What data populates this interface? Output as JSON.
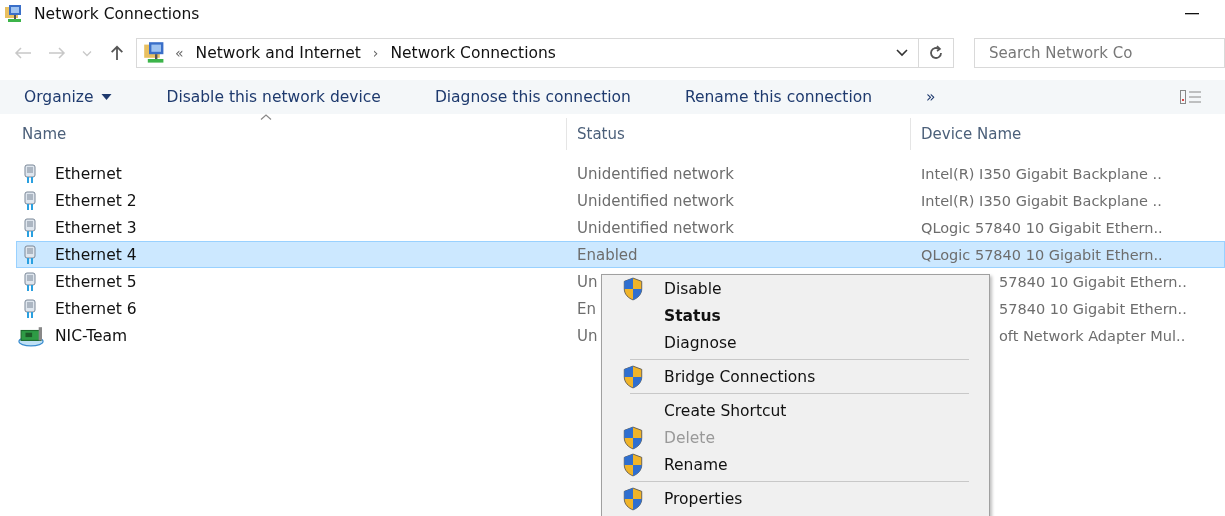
{
  "window": {
    "title": "Network Connections"
  },
  "address": {
    "prefix": "«",
    "separator": "›",
    "crumbs": [
      "Network and Internet",
      "Network Connections"
    ]
  },
  "search": {
    "placeholder": "Search Network Co"
  },
  "toolbar": {
    "items": [
      {
        "label": "Organize",
        "kind": "menu"
      },
      {
        "label": "Disable this network device",
        "kind": "command"
      },
      {
        "label": "Diagnose this connection",
        "kind": "command"
      },
      {
        "label": "Rename this connection",
        "kind": "command"
      }
    ],
    "more": "»"
  },
  "columns": [
    {
      "label": "Name",
      "sorted": true
    },
    {
      "label": "Status",
      "sorted": false
    },
    {
      "label": "Device Name",
      "sorted": false
    }
  ],
  "rows": [
    {
      "name": "Ethernet",
      "status": "Unidentified network",
      "device": "Intel(R) I350 Gigabit Backplane ..",
      "kind": "ethernet",
      "selected": false,
      "device_covered": false
    },
    {
      "name": "Ethernet 2",
      "status": "Unidentified network",
      "device": "Intel(R) I350 Gigabit Backplane ..",
      "kind": "ethernet",
      "selected": false,
      "device_covered": false
    },
    {
      "name": "Ethernet 3",
      "status": "Unidentified network",
      "device": "QLogic 57840 10 Gigabit Ethern..",
      "kind": "ethernet",
      "selected": false,
      "device_covered": false
    },
    {
      "name": "Ethernet 4",
      "status": "Enabled",
      "device": "QLogic 57840 10 Gigabit Ethern..",
      "kind": "ethernet",
      "selected": true,
      "device_covered": false
    },
    {
      "name": "Ethernet 5",
      "status": "Un",
      "device": "57840 10 Gigabit Ethern..",
      "kind": "ethernet",
      "selected": false,
      "device_covered": true
    },
    {
      "name": "Ethernet 6",
      "status": "En",
      "device": "57840 10 Gigabit Ethern..",
      "kind": "ethernet",
      "selected": false,
      "device_covered": true
    },
    {
      "name": "NIC-Team",
      "status": "Un",
      "device": "oft Network Adapter Mul..",
      "kind": "team",
      "selected": false,
      "device_covered": true
    }
  ],
  "context_menu": [
    {
      "kind": "item",
      "label": "Disable",
      "shield": true,
      "bold": false,
      "disabled": false
    },
    {
      "kind": "item",
      "label": "Status",
      "shield": false,
      "bold": true,
      "disabled": false
    },
    {
      "kind": "item",
      "label": "Diagnose",
      "shield": false,
      "bold": false,
      "disabled": false
    },
    {
      "kind": "separator"
    },
    {
      "kind": "item",
      "label": "Bridge Connections",
      "shield": true,
      "bold": false,
      "disabled": false
    },
    {
      "kind": "separator"
    },
    {
      "kind": "item",
      "label": "Create Shortcut",
      "shield": false,
      "bold": false,
      "disabled": false
    },
    {
      "kind": "item",
      "label": "Delete",
      "shield": true,
      "bold": false,
      "disabled": true
    },
    {
      "kind": "item",
      "label": "Rename",
      "shield": true,
      "bold": false,
      "disabled": false
    },
    {
      "kind": "separator"
    },
    {
      "kind": "item",
      "label": "Properties",
      "shield": true,
      "bold": false,
      "disabled": false
    }
  ]
}
